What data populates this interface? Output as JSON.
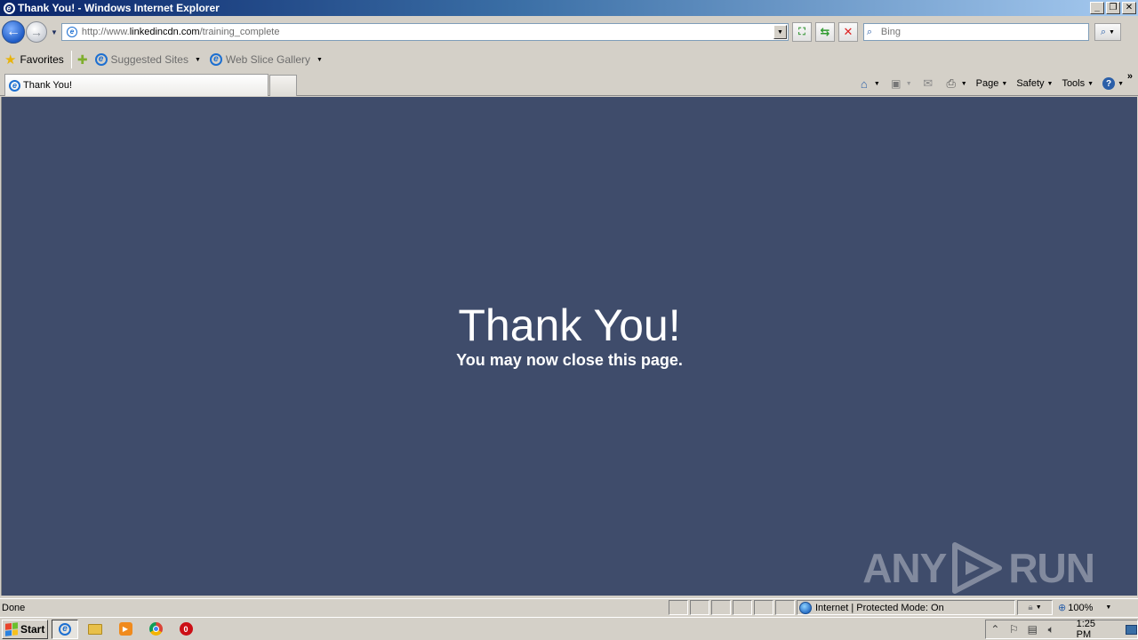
{
  "window": {
    "title": "Thank You! - Windows Internet Explorer"
  },
  "address": {
    "url_prefix": "http://www.",
    "url_domain": "linkedincdn.com",
    "url_path": "/training_complete"
  },
  "search": {
    "placeholder": "Bing"
  },
  "favorites": {
    "label": "Favorites",
    "items": [
      {
        "label": "Suggested Sites"
      },
      {
        "label": "Web Slice Gallery"
      }
    ]
  },
  "tabs": [
    {
      "label": "Thank You!"
    }
  ],
  "commands": {
    "page": "Page",
    "safety": "Safety",
    "tools": "Tools"
  },
  "page": {
    "headline": "Thank You!",
    "subline": "You may now close this page."
  },
  "watermark": {
    "left": "ANY",
    "right": "RUN"
  },
  "status": {
    "text": "Done",
    "zone": "Internet | Protected Mode: On",
    "zoom": "100%"
  },
  "taskbar": {
    "start": "Start",
    "clock": "1:25 PM"
  },
  "colors": {
    "content_bg": "#3f4c6b",
    "chrome": "#d4d0c8",
    "title_start": "#0a246a"
  }
}
